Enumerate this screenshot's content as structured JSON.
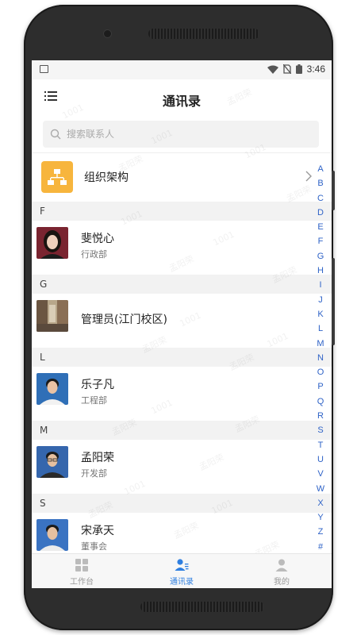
{
  "status_bar": {
    "time": "3:46"
  },
  "header": {
    "title": "通讯录"
  },
  "search": {
    "placeholder": "搜索联系人"
  },
  "org": {
    "label": "组织架构"
  },
  "sections": [
    {
      "letter": "F",
      "contacts": [
        {
          "name": "斐悦心",
          "dept": "行政部"
        }
      ]
    },
    {
      "letter": "G",
      "contacts": [
        {
          "name": "管理员(江门校区)",
          "dept": ""
        }
      ]
    },
    {
      "letter": "L",
      "contacts": [
        {
          "name": "乐子凡",
          "dept": "工程部"
        }
      ]
    },
    {
      "letter": "M",
      "contacts": [
        {
          "name": "孟阳荣",
          "dept": "开发部"
        }
      ]
    },
    {
      "letter": "S",
      "contacts": [
        {
          "name": "宋承天",
          "dept": "董事会"
        }
      ]
    }
  ],
  "alpha_index": [
    "A",
    "B",
    "C",
    "D",
    "E",
    "F",
    "G",
    "H",
    "I",
    "J",
    "K",
    "L",
    "M",
    "N",
    "O",
    "P",
    "Q",
    "R",
    "S",
    "T",
    "U",
    "V",
    "W",
    "X",
    "Y",
    "Z",
    "#"
  ],
  "tabs": [
    {
      "label": "工作台",
      "icon": "grid-icon",
      "active": false
    },
    {
      "label": "通讯录",
      "icon": "contacts-icon",
      "active": true
    },
    {
      "label": "我的",
      "icon": "person-icon",
      "active": false
    }
  ],
  "watermark": {
    "name": "孟阳荣",
    "id": "1001"
  },
  "colors": {
    "accent": "#2f7fe0",
    "org_icon": "#f7b53d",
    "index_letter": "#2f63c7"
  }
}
